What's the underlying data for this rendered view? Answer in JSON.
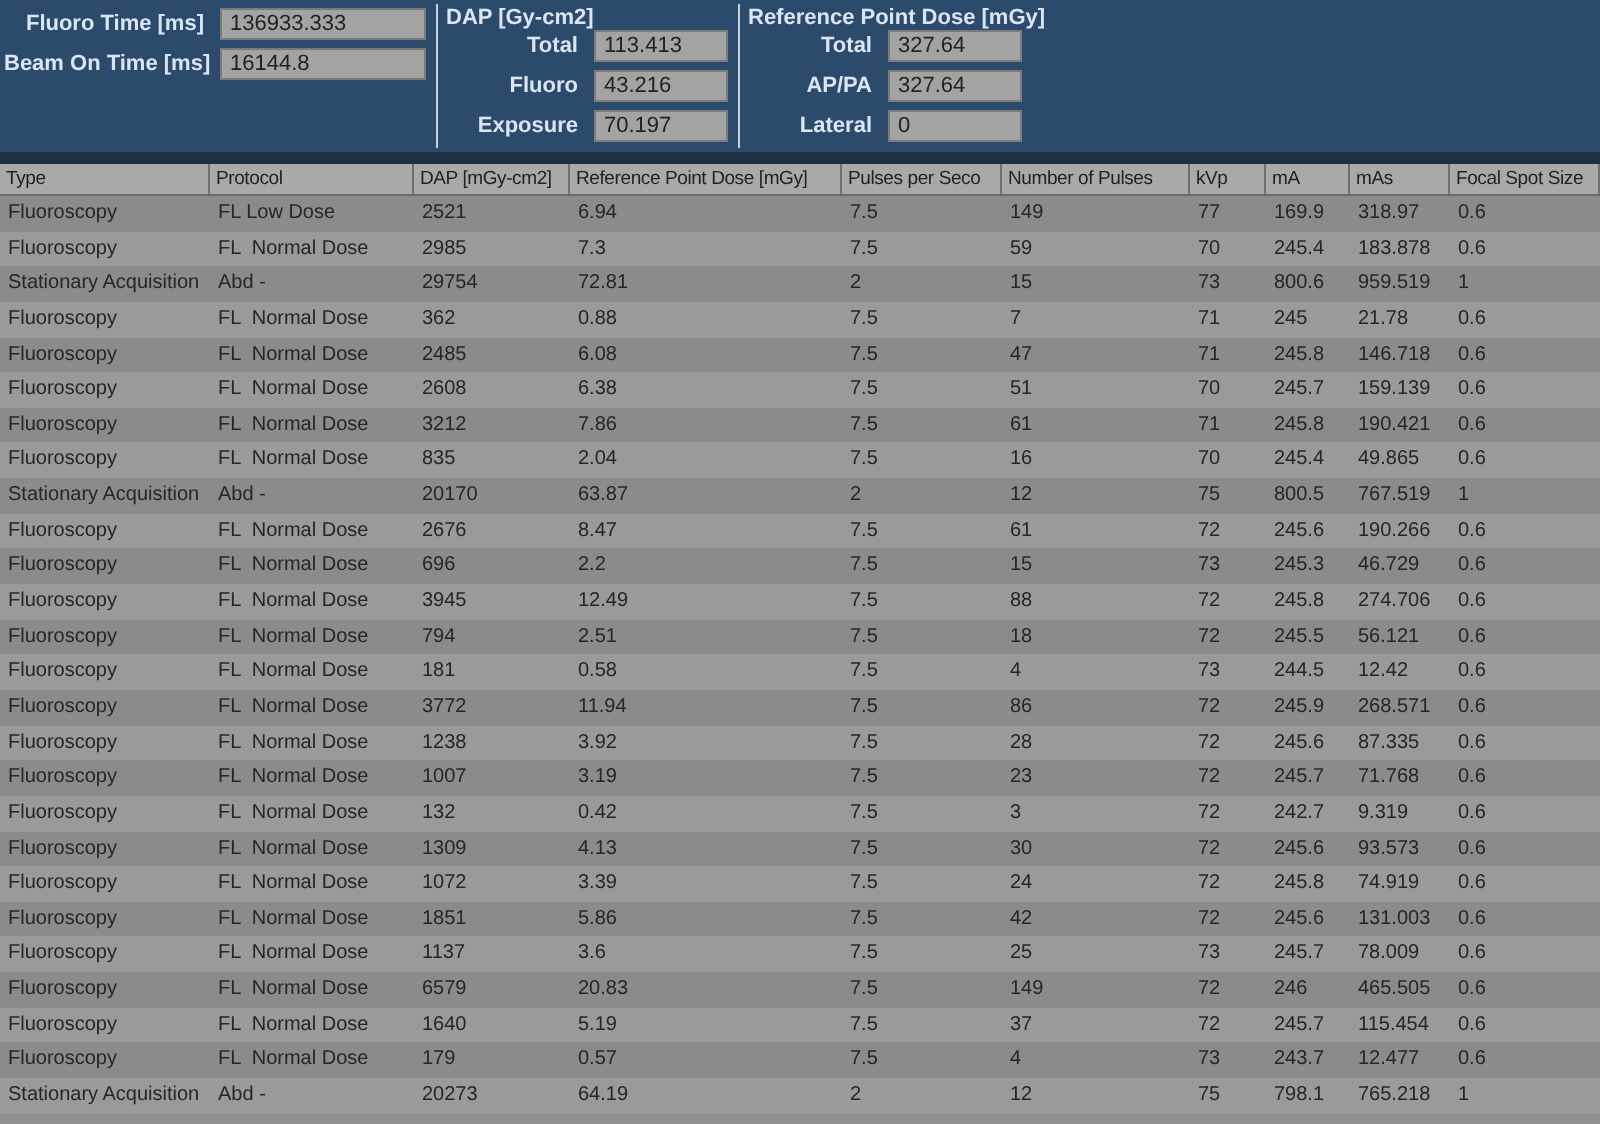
{
  "summary": {
    "time_fields": [
      {
        "label": "Fluoro Time [ms]",
        "value": "136933.333"
      },
      {
        "label": "Beam On Time [ms]",
        "value": "16144.8"
      }
    ],
    "dap": {
      "title": "DAP [Gy-cm2]",
      "fields": [
        {
          "label": "Total",
          "value": "113.413"
        },
        {
          "label": "Fluoro",
          "value": "43.216"
        },
        {
          "label": "Exposure",
          "value": "70.197"
        }
      ]
    },
    "reference_point_dose": {
      "title": "Reference Point Dose [mGy]",
      "fields": [
        {
          "label": "Total",
          "value": "327.64"
        },
        {
          "label": "AP/PA",
          "value": "327.64"
        },
        {
          "label": "Lateral",
          "value": "0"
        }
      ]
    }
  },
  "table": {
    "columns": [
      "Type",
      "Protocol",
      "DAP [mGy-cm2]",
      "Reference Point Dose [mGy]",
      "Pulses per Seco",
      "Number of Pulses",
      "kVp",
      "mA",
      "mAs",
      "Focal Spot Size"
    ],
    "rows": [
      [
        "Fluoroscopy",
        "FL Low Dose",
        "2521",
        "6.94",
        "7.5",
        "149",
        "77",
        "169.9",
        "318.97",
        "0.6"
      ],
      [
        "Fluoroscopy",
        "FL  Normal Dose",
        "2985",
        "7.3",
        "7.5",
        "59",
        "70",
        "245.4",
        "183.878",
        "0.6"
      ],
      [
        "Stationary Acquisition",
        "Abd -",
        "29754",
        "72.81",
        "2",
        "15",
        "73",
        "800.6",
        "959.519",
        "1"
      ],
      [
        "Fluoroscopy",
        "FL  Normal Dose",
        "362",
        "0.88",
        "7.5",
        "7",
        "71",
        "245",
        "21.78",
        "0.6"
      ],
      [
        "Fluoroscopy",
        "FL  Normal Dose",
        "2485",
        "6.08",
        "7.5",
        "47",
        "71",
        "245.8",
        "146.718",
        "0.6"
      ],
      [
        "Fluoroscopy",
        "FL  Normal Dose",
        "2608",
        "6.38",
        "7.5",
        "51",
        "70",
        "245.7",
        "159.139",
        "0.6"
      ],
      [
        "Fluoroscopy",
        "FL  Normal Dose",
        "3212",
        "7.86",
        "7.5",
        "61",
        "71",
        "245.8",
        "190.421",
        "0.6"
      ],
      [
        "Fluoroscopy",
        "FL  Normal Dose",
        "835",
        "2.04",
        "7.5",
        "16",
        "70",
        "245.4",
        "49.865",
        "0.6"
      ],
      [
        "Stationary Acquisition",
        "Abd -",
        "20170",
        "63.87",
        "2",
        "12",
        "75",
        "800.5",
        "767.519",
        "1"
      ],
      [
        "Fluoroscopy",
        "FL  Normal Dose",
        "2676",
        "8.47",
        "7.5",
        "61",
        "72",
        "245.6",
        "190.266",
        "0.6"
      ],
      [
        "Fluoroscopy",
        "FL  Normal Dose",
        "696",
        "2.2",
        "7.5",
        "15",
        "73",
        "245.3",
        "46.729",
        "0.6"
      ],
      [
        "Fluoroscopy",
        "FL  Normal Dose",
        "3945",
        "12.49",
        "7.5",
        "88",
        "72",
        "245.8",
        "274.706",
        "0.6"
      ],
      [
        "Fluoroscopy",
        "FL  Normal Dose",
        "794",
        "2.51",
        "7.5",
        "18",
        "72",
        "245.5",
        "56.121",
        "0.6"
      ],
      [
        "Fluoroscopy",
        "FL  Normal Dose",
        "181",
        "0.58",
        "7.5",
        "4",
        "73",
        "244.5",
        "12.42",
        "0.6"
      ],
      [
        "Fluoroscopy",
        "FL  Normal Dose",
        "3772",
        "11.94",
        "7.5",
        "86",
        "72",
        "245.9",
        "268.571",
        "0.6"
      ],
      [
        "Fluoroscopy",
        "FL  Normal Dose",
        "1238",
        "3.92",
        "7.5",
        "28",
        "72",
        "245.6",
        "87.335",
        "0.6"
      ],
      [
        "Fluoroscopy",
        "FL  Normal Dose",
        "1007",
        "3.19",
        "7.5",
        "23",
        "72",
        "245.7",
        "71.768",
        "0.6"
      ],
      [
        "Fluoroscopy",
        "FL  Normal Dose",
        "132",
        "0.42",
        "7.5",
        "3",
        "72",
        "242.7",
        "9.319",
        "0.6"
      ],
      [
        "Fluoroscopy",
        "FL  Normal Dose",
        "1309",
        "4.13",
        "7.5",
        "30",
        "72",
        "245.6",
        "93.573",
        "0.6"
      ],
      [
        "Fluoroscopy",
        "FL  Normal Dose",
        "1072",
        "3.39",
        "7.5",
        "24",
        "72",
        "245.8",
        "74.919",
        "0.6"
      ],
      [
        "Fluoroscopy",
        "FL  Normal Dose",
        "1851",
        "5.86",
        "7.5",
        "42",
        "72",
        "245.6",
        "131.003",
        "0.6"
      ],
      [
        "Fluoroscopy",
        "FL  Normal Dose",
        "1137",
        "3.6",
        "7.5",
        "25",
        "73",
        "245.7",
        "78.009",
        "0.6"
      ],
      [
        "Fluoroscopy",
        "FL  Normal Dose",
        "6579",
        "20.83",
        "7.5",
        "149",
        "72",
        "246",
        "465.505",
        "0.6"
      ],
      [
        "Fluoroscopy",
        "FL  Normal Dose",
        "1640",
        "5.19",
        "7.5",
        "37",
        "72",
        "245.7",
        "115.454",
        "0.6"
      ],
      [
        "Fluoroscopy",
        "FL  Normal Dose",
        "179",
        "0.57",
        "7.5",
        "4",
        "73",
        "243.7",
        "12.477",
        "0.6"
      ],
      [
        "Stationary Acquisition",
        "Abd -",
        "20273",
        "64.19",
        "2",
        "12",
        "75",
        "798.1",
        "765.218",
        "1"
      ]
    ]
  }
}
